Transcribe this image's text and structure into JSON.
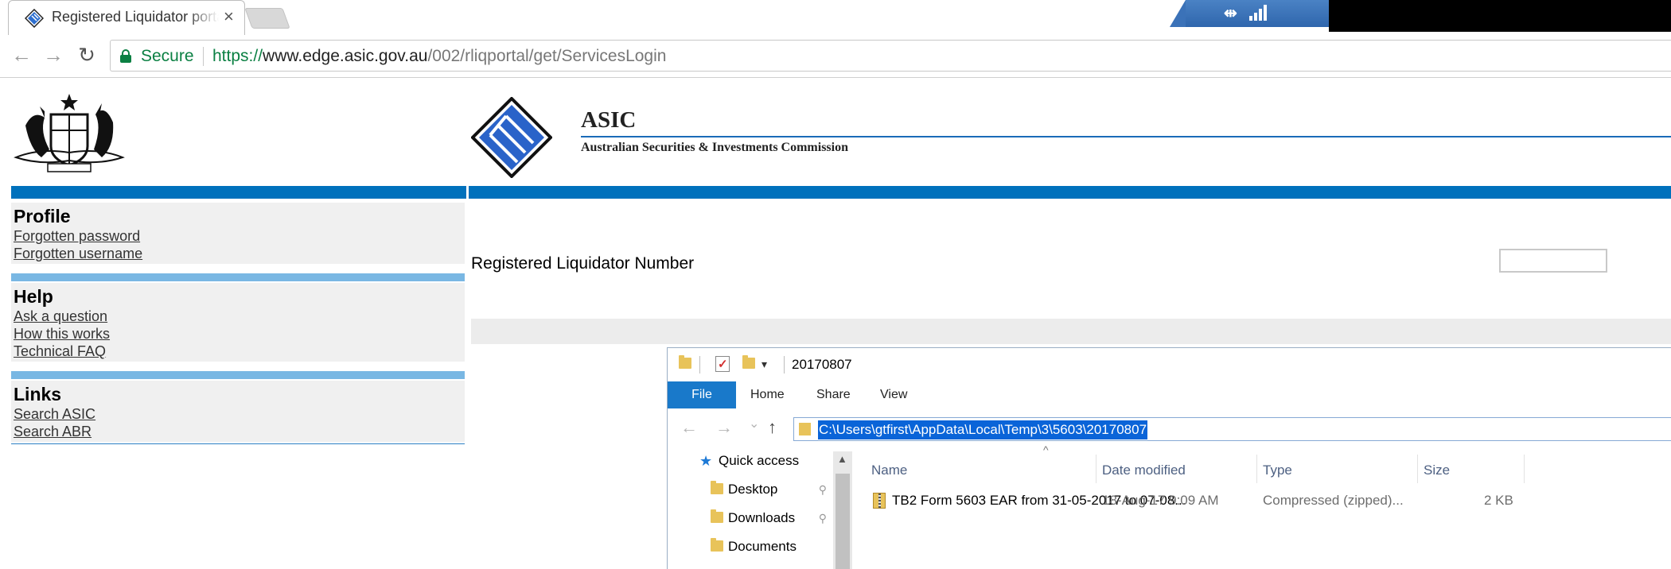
{
  "browser": {
    "tab_title": "Registered Liquidator portal",
    "tab_close": "×",
    "url": {
      "scheme": "https://",
      "host": "www.edge.asic.gov.au",
      "path": "/002/rliqportal/get/ServicesLogin"
    },
    "secure_label": "Secure",
    "back_glyph": "←",
    "forward_glyph": "→",
    "reload_glyph": "↻",
    "net_glyph": "⇹"
  },
  "header": {
    "org_short": "ASIC",
    "org_full": "Australian Securities & Investments Commission"
  },
  "sidebar": {
    "profile": {
      "heading": "Profile",
      "links": [
        "Forgotten password",
        "Forgotten username"
      ]
    },
    "help": {
      "heading": "Help",
      "links": [
        "Ask a question",
        "How this works",
        "Technical FAQ"
      ]
    },
    "links": {
      "heading": "Links",
      "links": [
        "Search ASIC",
        "Search ABR"
      ]
    }
  },
  "main": {
    "rl_number_label": "Registered Liquidator Number",
    "rl_number_value": ""
  },
  "explorer": {
    "title": "20170807",
    "dropdown_glyph": "▾",
    "ribbon": {
      "file": "File",
      "tabs": [
        "Home",
        "Share",
        "View"
      ]
    },
    "nav_glyphs": {
      "back": "←",
      "forward": "→",
      "recent": "⌄",
      "up": "↑"
    },
    "path": "C:\\Users\\gtfirst\\AppData\\Local\\Temp\\3\\5603\\20170807",
    "nav_pane": {
      "quick_access": "Quick access",
      "items": [
        "Desktop",
        "Downloads",
        "Documents"
      ],
      "pin_glyph": "📌"
    },
    "columns": [
      "Name",
      "Date modified",
      "Type",
      "Size"
    ],
    "sort_caret": "^",
    "files": [
      {
        "name": "TB2 Form 5603 EAR from 31-05-2017 to 07-08...",
        "date_modified": "18-Aug-17 9:09 AM",
        "type": "Compressed (zipped)...",
        "size": "2 KB"
      }
    ]
  },
  "colors": {
    "asic_blue": "#0071bc",
    "light_blue": "#79b7e3",
    "secure_green": "#0b8043",
    "selection_blue": "#0a64d8",
    "ribbon_file_blue": "#1979ca"
  }
}
